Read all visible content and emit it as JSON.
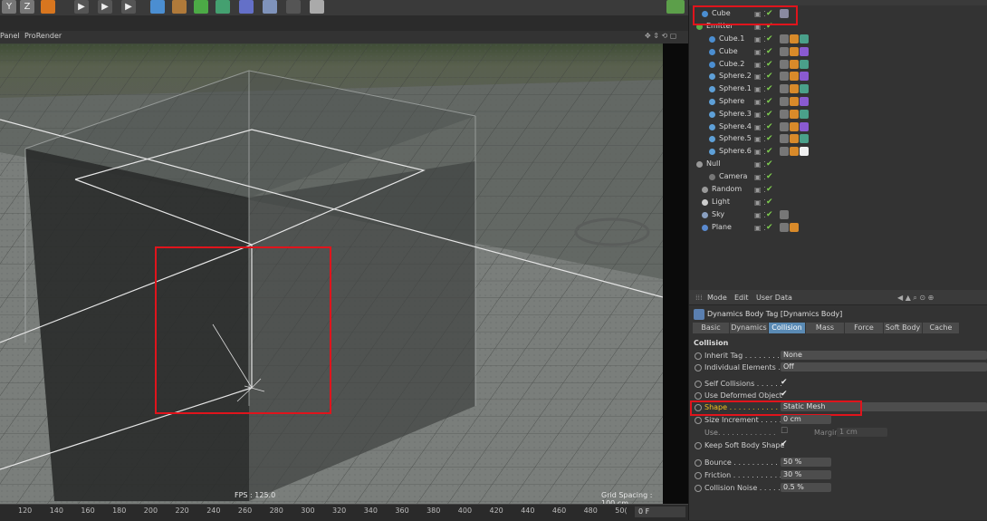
{
  "viewport": {
    "panel_label": "Panel",
    "renderer_label": "ProRender",
    "fps": "FPS : 125.0",
    "grid_spacing": "Grid Spacing : 100 cm",
    "ruler_ticks": [
      "120",
      "140",
      "160",
      "180",
      "200",
      "220",
      "240",
      "260",
      "280",
      "300",
      "320",
      "340",
      "360",
      "380",
      "400",
      "420",
      "440",
      "460",
      "480",
      "50("
    ],
    "frame_field": "0 F"
  },
  "toolbar": {
    "y_label": "Y",
    "z_label": "Z"
  },
  "object_manager": {
    "top_row_label": "Cube",
    "emitter_label": "Emitter",
    "objects": [
      {
        "name": "Cube.1",
        "type": "cube"
      },
      {
        "name": "Cube",
        "type": "cube"
      },
      {
        "name": "Cube.2",
        "type": "cube"
      },
      {
        "name": "Sphere.2",
        "type": "sphere"
      },
      {
        "name": "Sphere.1",
        "type": "sphere"
      },
      {
        "name": "Sphere",
        "type": "sphere"
      },
      {
        "name": "Sphere.3",
        "type": "sphere"
      },
      {
        "name": "Sphere.4",
        "type": "sphere"
      },
      {
        "name": "Sphere.5",
        "type": "sphere"
      },
      {
        "name": "Sphere.6",
        "type": "sphere"
      }
    ],
    "null_label": "Null",
    "camera_label": "Camera",
    "random_label": "Random",
    "light_label": "Light",
    "sky_label": "Sky",
    "plane_label": "Plane"
  },
  "attribute_manager": {
    "menu": {
      "mode": "Mode",
      "edit": "Edit",
      "user_data": "User Data"
    },
    "tag_title": "Dynamics Body Tag [Dynamics Body]",
    "tabs": [
      "Basic",
      "Dynamics",
      "Collision",
      "Mass",
      "Force",
      "Soft Body",
      "Cache"
    ],
    "active_tab": "Collision",
    "section": "Collision",
    "params": {
      "inherit_tag_label": "Inherit Tag . . . . . . . . .",
      "inherit_tag_value": "None",
      "individual_elements_label": "Individual Elements . . .",
      "individual_elements_value": "Off",
      "self_collisions_label": "Self Collisions . . . . . .",
      "use_deformed_label": "Use Deformed Object",
      "shape_label": "Shape . . . . . . . . . . . . .",
      "shape_value": "Static Mesh",
      "size_increment_label": "Size Increment . . . . .",
      "size_increment_value": "0 cm",
      "use_label": "Use. . . . . . . . . . . . .",
      "margin_label": "Margin",
      "margin_value": "1 cm",
      "keep_soft_body_label": "Keep Soft Body Shape",
      "bounce_label": "Bounce . . . . . . . . . . . .",
      "bounce_value": "50 %",
      "friction_label": "Friction . . . . . . . . . . . .",
      "friction_value": "30 %",
      "collision_noise_label": "Collision Noise . . . . . .",
      "collision_noise_value": "0.5 %"
    }
  },
  "colors": {
    "highlight": "#e0141c",
    "active_tab": "#5a8ab4",
    "check_green": "#7fcf4f"
  }
}
